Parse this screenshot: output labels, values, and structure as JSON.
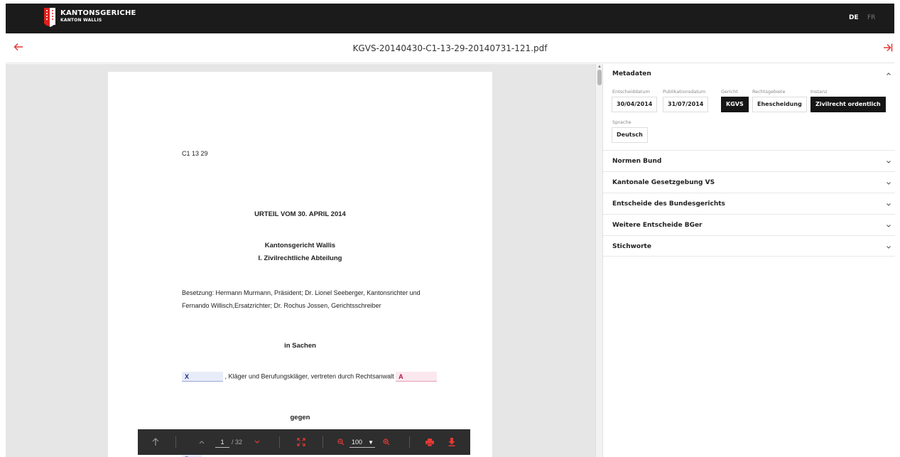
{
  "header": {
    "brand_title": "KANTONSGERICHE",
    "brand_subtitle": "KANTON WALLIS",
    "languages": [
      {
        "label": "DE",
        "active": true
      },
      {
        "label": "FR",
        "active": false
      }
    ]
  },
  "titlebar": {
    "filename": "KGVS-20140430-C1-13-29-20140731-121.pdf",
    "accent_color": "#e53935"
  },
  "document": {
    "case_number": "C1 13 29",
    "heading": "URTEIL VOM 30. APRIL 2014",
    "court": "Kantonsgericht Wallis",
    "division": "I. Zivilrechtliche Abteilung",
    "composition_line1": "Besetzung: Hermann Murmann, Präsident; Dr. Lionel Seeberger, Kantonsrichter und",
    "composition_line2": "Fernando Willisch,Ersatzrichter; Dr. Rochus Jossen, Gerichtsschreiber",
    "in_matter": "in Sachen",
    "party_x": "X",
    "party_x_text": ", Kläger und Berufungskläger, vertreten durch Rechtsanwalt",
    "party_a": "A",
    "against": "gegen",
    "party_b": "B"
  },
  "toolbar": {
    "current_page": "1",
    "total_pages": "/ 32",
    "zoom": "100"
  },
  "panel": {
    "metadata": {
      "title": "Metadaten",
      "fields": {
        "decision_date_label": "Entscheiddatum",
        "decision_date": "30/04/2014",
        "publication_date_label": "Publikationsdatum",
        "publication_date": "31/07/2014",
        "court_label": "Gericht",
        "court": "KGVS",
        "legal_area_label": "Rechtsgebiete",
        "legal_area": "Ehescheidung",
        "instance_label": "Instanz",
        "instance": "Zivilrecht ordentlich",
        "language_label": "Sprache",
        "language": "Deutsch"
      }
    },
    "sections": [
      "Normen Bund",
      "Kantonale Gesetzgebung VS",
      "Entscheide des Bundesgerichts",
      "Weitere Entscheide BGer",
      "Stichworte"
    ]
  }
}
